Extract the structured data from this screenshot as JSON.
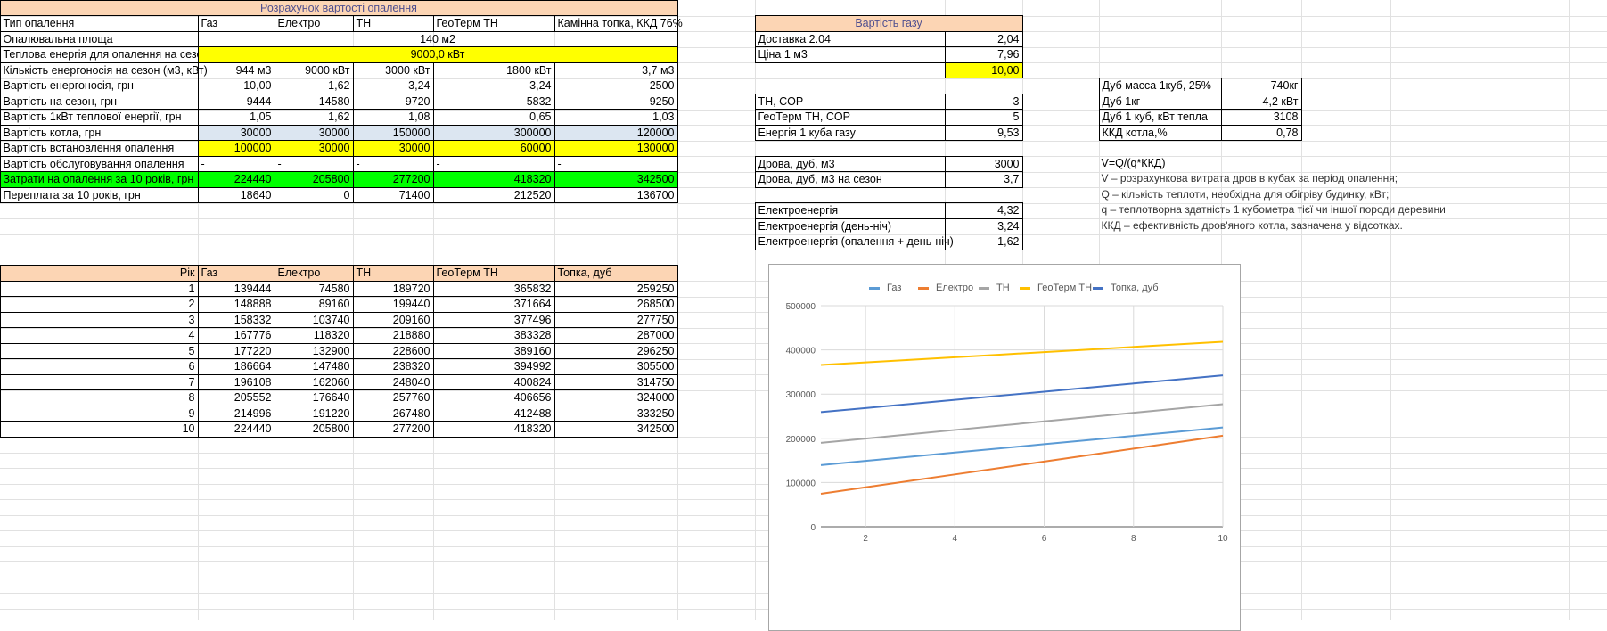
{
  "main_table": {
    "title": "Розрахунок вартості опалення",
    "header": [
      "Тип опалення",
      "Газ",
      "Електро",
      "ТН",
      "ГеоТерм ТН",
      "Камінна топка, ККД 76%"
    ],
    "area": {
      "label": "Опалювальна площа",
      "value": "140 м2"
    },
    "heat": {
      "label": "Теплова енергія для опалення на сезон",
      "value": "9000,0 кВт"
    },
    "rows": [
      {
        "label": "Кількість енергоносія на сезон (м3, кВт)",
        "values": [
          "944 м3",
          "9000 кВт",
          "3000 кВт",
          "1800 кВт",
          "3,7 м3"
        ]
      },
      {
        "label": "Вартість енергоносія, грн",
        "values": [
          "10,00",
          "1,62",
          "3,24",
          "3,24",
          "2500"
        ]
      },
      {
        "label": "Вартість на сезон, грн",
        "values": [
          "9444",
          "14580",
          "9720",
          "5832",
          "9250"
        ]
      },
      {
        "label": "Вартість 1кВт теплової енергії, грн",
        "values": [
          "1,05",
          "1,62",
          "1,08",
          "0,65",
          "1,03"
        ]
      },
      {
        "label": "Вартість котла, грн",
        "values": [
          "30000",
          "30000",
          "150000",
          "300000",
          "120000"
        ]
      },
      {
        "label": "Вартість встановлення опалення",
        "values": [
          "100000",
          "30000",
          "30000",
          "60000",
          "130000"
        ]
      },
      {
        "label": "Вартість обслуговування опалення",
        "values": [
          "-",
          "-",
          "-",
          "-",
          "-"
        ]
      },
      {
        "label": "Затрати на опалення за 10 років, грн",
        "values": [
          "224440",
          "205800",
          "277200",
          "418320",
          "342500"
        ]
      },
      {
        "label": "Переплата за 10 років, грн",
        "values": [
          "18640",
          "0",
          "71400",
          "212520",
          "136700"
        ]
      }
    ]
  },
  "years_table": {
    "header": [
      "Рік",
      "Газ",
      "Електро",
      "ТН",
      "ГеоТерм ТН",
      "Топка, дуб"
    ],
    "rows": [
      [
        "1",
        "139444",
        "74580",
        "189720",
        "365832",
        "259250"
      ],
      [
        "2",
        "148888",
        "89160",
        "199440",
        "371664",
        "268500"
      ],
      [
        "3",
        "158332",
        "103740",
        "209160",
        "377496",
        "277750"
      ],
      [
        "4",
        "167776",
        "118320",
        "218880",
        "383328",
        "287000"
      ],
      [
        "5",
        "177220",
        "132900",
        "228600",
        "389160",
        "296250"
      ],
      [
        "6",
        "186664",
        "147480",
        "238320",
        "394992",
        "305500"
      ],
      [
        "7",
        "196108",
        "162060",
        "248040",
        "400824",
        "314750"
      ],
      [
        "8",
        "205552",
        "176640",
        "257760",
        "406656",
        "324000"
      ],
      [
        "9",
        "214996",
        "191220",
        "267480",
        "412488",
        "333250"
      ],
      [
        "10",
        "224440",
        "205800",
        "277200",
        "418320",
        "342500"
      ]
    ]
  },
  "gas_table": {
    "title": "Вартість газу",
    "rows": [
      {
        "label": "Доставка 2.04",
        "value": "2,04"
      },
      {
        "label": "Ціна 1 м3",
        "value": "7,96"
      },
      {
        "label": "",
        "value": "10,00"
      }
    ],
    "cop_rows": [
      {
        "label": "ТН, COP",
        "value": "3"
      },
      {
        "label": "ГеоТерм ТН, COP",
        "value": "5"
      },
      {
        "label": "Енергія 1 куба газу",
        "value": "9,53"
      }
    ],
    "wood_rows": [
      {
        "label": "Дрова, дуб, м3",
        "value": "3000"
      },
      {
        "label": "Дрова, дуб, м3 на сезон",
        "value": "3,7"
      }
    ],
    "elec_rows": [
      {
        "label": "Електроенергія",
        "value": "4,32"
      },
      {
        "label": "Електроенергія (день-ніч)",
        "value": "3,24"
      },
      {
        "label": "Електроенергія (опалення + день-ніч)",
        "value": "1,62"
      }
    ]
  },
  "oak_table": {
    "rows": [
      {
        "label": "Дуб масса 1куб, 25%",
        "value": "740кг"
      },
      {
        "label": "Дуб 1кг",
        "value": "4,2 кВт"
      },
      {
        "label": "Дуб 1 куб, кВт тепла",
        "value": "3108"
      },
      {
        "label": "ККД котла,%",
        "value": "0,78"
      }
    ]
  },
  "formula": {
    "main": "V=Q/(q*ККД)",
    "notes": [
      "V – розрахункова витрата дров в кубах за період опалення;",
      "Q – кількість теплоти, необхідна для обігріву будинку, кВт;",
      "q – теплотворна здатність 1 кубометра тієї чи іншої породи деревини",
      "ККД – ефективність дров'яного котла, зазначена у відсотках."
    ]
  },
  "chart_data": {
    "type": "line",
    "title": "",
    "xlabel": "",
    "ylabel": "",
    "x": [
      1,
      2,
      3,
      4,
      5,
      6,
      7,
      8,
      9,
      10
    ],
    "xticks": [
      "2",
      "4",
      "6",
      "8",
      "10"
    ],
    "yticks": [
      "0",
      "100000",
      "200000",
      "300000",
      "400000",
      "500000"
    ],
    "ylim": [
      0,
      500000
    ],
    "xlim": [
      1,
      10
    ],
    "grid": true,
    "legend": "top",
    "series": [
      {
        "name": "Газ",
        "color": "#5b9bd5",
        "values": [
          139444,
          148888,
          158332,
          167776,
          177220,
          186664,
          196108,
          205552,
          214996,
          224440
        ]
      },
      {
        "name": "Електро",
        "color": "#ed7d31",
        "values": [
          74580,
          89160,
          103740,
          118320,
          132900,
          147480,
          162060,
          176640,
          191220,
          205800
        ]
      },
      {
        "name": "ТН",
        "color": "#a5a5a5",
        "values": [
          189720,
          199440,
          209160,
          218880,
          228600,
          238320,
          248040,
          257760,
          267480,
          277200
        ]
      },
      {
        "name": "ГеоТерм ТН",
        "color": "#ffc000",
        "values": [
          365832,
          371664,
          377496,
          383328,
          389160,
          394992,
          400824,
          406656,
          412488,
          418320
        ]
      },
      {
        "name": "Топка, дуб",
        "color": "#4472c4",
        "values": [
          259250,
          268500,
          277750,
          287000,
          296250,
          305500,
          314750,
          324000,
          333250,
          342500
        ]
      }
    ]
  }
}
